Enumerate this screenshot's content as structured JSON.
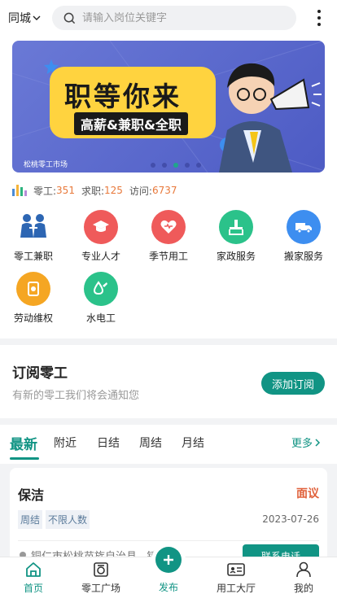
{
  "header": {
    "city": "同城",
    "search_placeholder": "请输入岗位关键字"
  },
  "banner": {
    "headline": "职等你来",
    "subline": "高薪&兼职&全职",
    "caption": "松桃零工市场",
    "slides": 5,
    "active_slide": 3
  },
  "stats": {
    "gig_label": "零工:",
    "gig_value": "351",
    "seek_label": "求职:",
    "seek_value": "125",
    "visit_label": "访问:",
    "visit_value": "6737"
  },
  "categories": [
    {
      "label": "零工兼职",
      "icon": "workers-icon",
      "color": "#ffffff"
    },
    {
      "label": "专业人才",
      "icon": "graduation-cap-icon",
      "color": "#ef5a5a"
    },
    {
      "label": "季节用工",
      "icon": "heart-icon",
      "color": "#ef5a5a"
    },
    {
      "label": "家政服务",
      "icon": "broom-icon",
      "color": "#2bc28a"
    },
    {
      "label": "搬家服务",
      "icon": "truck-icon",
      "color": "#3d8ef0"
    },
    {
      "label": "劳动维权",
      "icon": "shield-icon",
      "color": "#f5a623"
    },
    {
      "label": "水电工",
      "icon": "water-drop-icon",
      "color": "#2bc28a"
    }
  ],
  "subscribe": {
    "title": "订阅零工",
    "desc": "有新的零工我们将会通知您",
    "button": "添加订阅"
  },
  "tabs": {
    "items": [
      "最新",
      "附近",
      "日结",
      "周结",
      "月结"
    ],
    "active": 0,
    "more": "更多"
  },
  "job": {
    "title": "保洁",
    "pay": "面议",
    "tags": [
      "周结",
      "不限人数"
    ],
    "date": "2023-07-26",
    "location": "铜仁市松桃苗族自治县...镇",
    "contact": "联系电话"
  },
  "bottom_nav": [
    {
      "label": "首页",
      "icon": "home-icon"
    },
    {
      "label": "零工广场",
      "icon": "square-icon"
    },
    {
      "label": "发布",
      "icon": "plus-icon"
    },
    {
      "label": "用工大厅",
      "icon": "id-card-icon"
    },
    {
      "label": "我的",
      "icon": "user-icon"
    }
  ],
  "colors": {
    "accent": "#119484",
    "highlight": "#e8793b",
    "pay": "#e0603a"
  }
}
